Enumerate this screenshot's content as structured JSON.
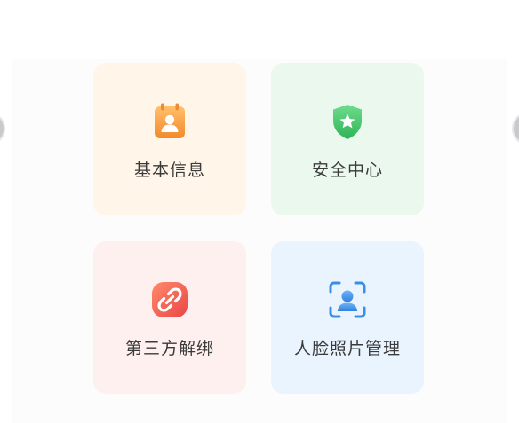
{
  "menu": {
    "items": [
      {
        "label": "基本信息",
        "icon": "id-card-icon",
        "color": "#f59a3c"
      },
      {
        "label": "安全中心",
        "icon": "shield-star-icon",
        "color": "#3fc266"
      },
      {
        "label": "第三方解绑",
        "icon": "unlink-icon",
        "color": "#f05b4e"
      },
      {
        "label": "人脸照片管理",
        "icon": "face-scan-icon",
        "color": "#3a8ee8"
      }
    ]
  }
}
